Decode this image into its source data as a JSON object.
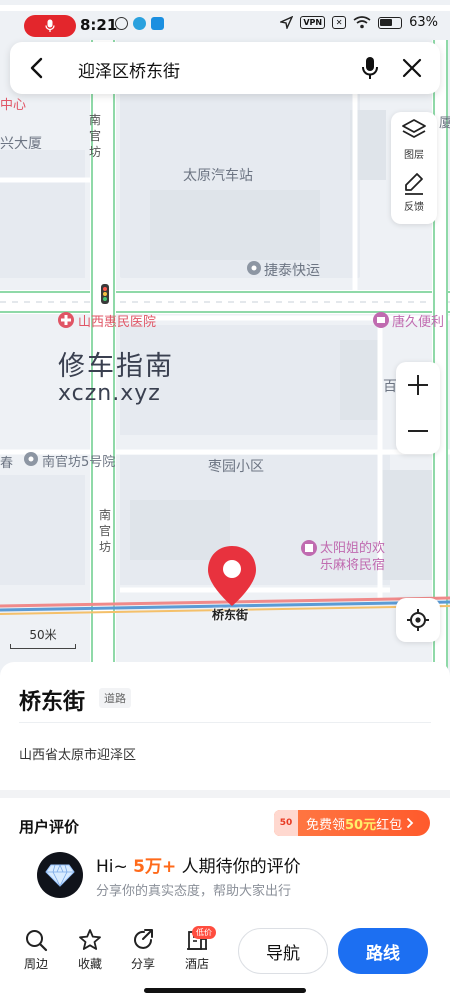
{
  "status_bar": {
    "time": "8:21",
    "vpn_label": "VPN",
    "battery_percent": "63%"
  },
  "search": {
    "query": "迎泽区桥东街"
  },
  "map": {
    "labels": {
      "center_partial": "中心",
      "building_partial": "兴大厦",
      "bus_station": "太原汽车站",
      "express": "捷泰快运",
      "hospital": "山西惠民医院",
      "store": "唐久便利",
      "road_nanguanfang_top": "南官坊",
      "road_nanguanfang_bottom": "南官坊",
      "courtyard": "南官坊5号院",
      "chun_partial": "春",
      "residential": "枣园小区",
      "mahjong_line1": "太阳姐的欢",
      "mahjong_line2": "乐麻将民宿",
      "right_partial": "百",
      "right_partial_top": "厦"
    },
    "watermark_cn": "修车指南",
    "watermark_en": "xczn.xyz",
    "street_label": "桥东街",
    "scale": "50米"
  },
  "tools": {
    "layers_label": "图层",
    "feedback_label": "反馈"
  },
  "place": {
    "name": "桥东街",
    "tag": "道路",
    "address": "山西省太原市迎泽区"
  },
  "reviews": {
    "title": "用户评价",
    "promo_envelope": "50",
    "promo_prefix": "免费领",
    "promo_amount": "50元",
    "promo_suffix": "红包",
    "hi_prefix": "Hi~ ",
    "hi_count": "5万+",
    "hi_suffix": " 人期待你的评价",
    "subtitle": "分享你的真实态度，帮助大家出行"
  },
  "bottom_nav": {
    "items": [
      {
        "label": "周边",
        "icon": "search-icon"
      },
      {
        "label": "收藏",
        "icon": "star-icon"
      },
      {
        "label": "分享",
        "icon": "share-icon"
      },
      {
        "label": "酒店",
        "icon": "hotel-icon"
      }
    ],
    "low_price_badge": "低价",
    "navigate_label": "导航",
    "route_label": "路线"
  },
  "colors": {
    "primary_blue": "#1c6ff2",
    "pin_red": "#e8323e",
    "promo_orange": "#ff6a1a",
    "road_green": "#8fd9a8"
  }
}
